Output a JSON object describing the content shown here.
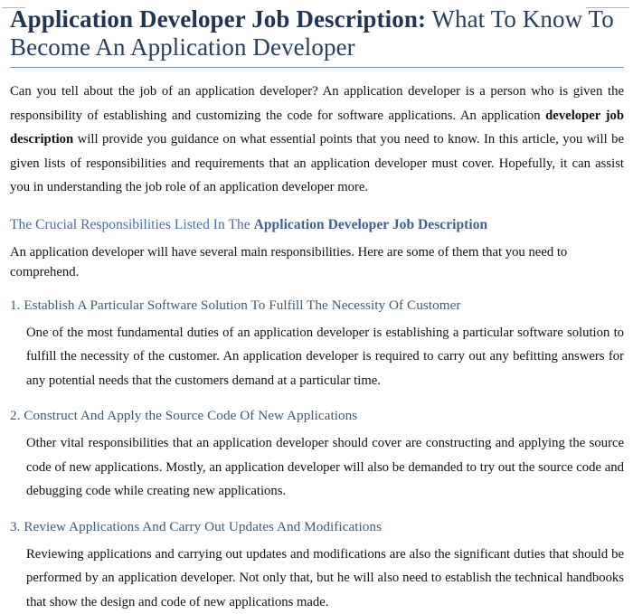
{
  "document": {
    "title_bold": "Application Developer Job Description:",
    "title_rest": " What To Know To Become An Application Developer",
    "intro": {
      "part1": "Can you tell about the job of an application developer? An application developer is a person who is given the responsibility of establishing and customizing the code for software applications. An application ",
      "bold": "developer job description",
      "part2": " will provide you guidance on what essential points that you need to know. In this article, you will be given lists of responsibilities and requirements that an application developer must cover. Hopefully, it can assist you in understanding the job role of an application developer more."
    },
    "section": {
      "heading_regular": "The Crucial Responsibilities Listed In The ",
      "heading_bold": "Application Developer Job Description",
      "lead": "An application developer will have several main responsibilities. Here are some of them that you need to comprehend."
    },
    "items": [
      {
        "number": "1.",
        "heading": "Establish A Particular Software Solution To Fulfill The Necessity Of Customer",
        "body": "One of the most fundamental duties of an application developer is establishing a particular software solution to fulfill the necessity of the customer. An application developer is required to carry out any befitting answers for any potential needs that the customers demand at a particular time."
      },
      {
        "number": "2.",
        "heading": "Construct And Apply the Source Code Of New Applications",
        "body": "Other vital responsibilities that an application developer should cover are constructing and applying the source code of new applications. Mostly, an application developer will also be demanded to try out the source code and debugging code while creating new applications."
      },
      {
        "number": "3.",
        "heading": "Review Applications And Carry Out Updates And Modifications",
        "body": "Reviewing applications and carrying out updates and modifications are also the significant duties that should be performed by an application developer. Not only that, but he will also need to establish the technical handbooks that show the design and code of new applications made."
      }
    ],
    "colors": {
      "title": "#27405e",
      "section_heading": "#4a6d9e",
      "item_heading": "#3d5a75",
      "rule": "#7d93ab",
      "body_text": "#111111"
    }
  }
}
